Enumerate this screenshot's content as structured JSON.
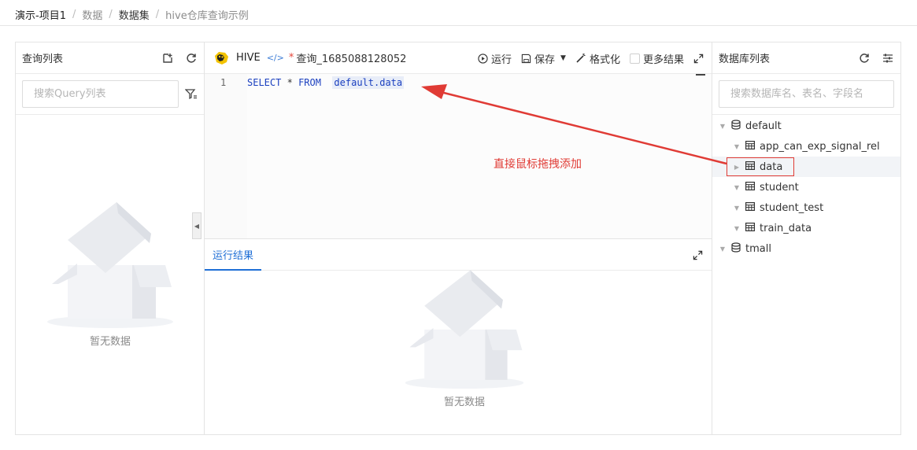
{
  "breadcrumb": [
    "演示-项目1",
    "数据",
    "数据集",
    "hive仓库查询示例"
  ],
  "left": {
    "title": "查询列表",
    "search_placeholder": "搜索Query列表",
    "empty_text": "暂无数据"
  },
  "editor": {
    "engine": "HIVE",
    "modified_mark": "*",
    "query_name": "查询_1685088128052",
    "run_label": "运行",
    "save_label": "保存",
    "format_label": "格式化",
    "more_results_label": "更多结果",
    "line_number": "1",
    "code": {
      "kw1": "SELECT",
      "star": "*",
      "kw2": "FROM",
      "table": "default.data"
    }
  },
  "results": {
    "tab_label": "运行结果",
    "empty_text": "暂无数据"
  },
  "right": {
    "title": "数据库列表",
    "search_placeholder": "搜索数据库名、表名、字段名",
    "databases": [
      {
        "name": "default",
        "tables": [
          "app_can_exp_signal_rel",
          "data",
          "student",
          "student_test",
          "train_data"
        ]
      },
      {
        "name": "tmall",
        "tables": []
      }
    ]
  },
  "annotation": "直接鼠标拖拽添加",
  "colors": {
    "accent": "#1f6fd6",
    "annotation": "#e03b35"
  }
}
